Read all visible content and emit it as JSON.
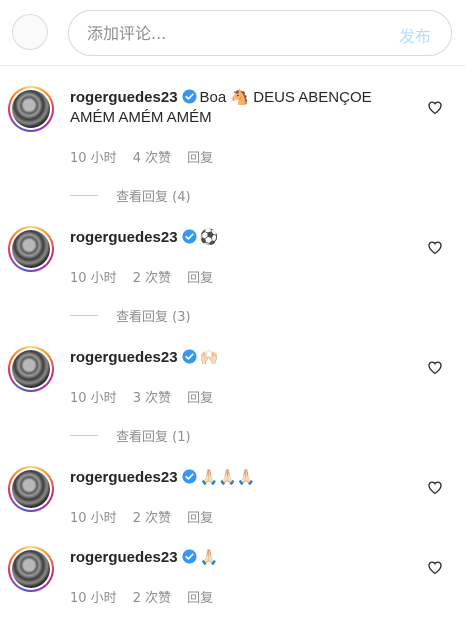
{
  "composer": {
    "placeholder": "添加评论...",
    "post_label": "发布"
  },
  "comments": [
    {
      "username": "rogerguedes23",
      "text": "Boa 🐴 DEUS ABENÇOE AMÉM AMÉM AMÉM",
      "time": "10 小时",
      "likes": "4 次赞",
      "reply": "回复",
      "view_replies": "查看回复 (4)"
    },
    {
      "username": "rogerguedes23",
      "text": "⚽",
      "time": "10 小时",
      "likes": "2 次赞",
      "reply": "回复",
      "view_replies": "查看回复 (3)"
    },
    {
      "username": "rogerguedes23",
      "text": "🙌🏻",
      "time": "10 小时",
      "likes": "3 次赞",
      "reply": "回复",
      "view_replies": "查看回复 (1)"
    },
    {
      "username": "rogerguedes23",
      "text": "🙏🏻🙏🏻🙏🏻",
      "time": "10 小时",
      "likes": "2 次赞",
      "reply": "回复"
    },
    {
      "username": "rogerguedes23",
      "text": "🙏🏻",
      "time": "10 小时",
      "likes": "2 次赞",
      "reply": "回复"
    }
  ],
  "colors": {
    "verified": "#3897f0",
    "muted_text": "#8e8e8e",
    "post_disabled": "#b2dffc"
  },
  "icons": {
    "verified": "verified-badge-icon",
    "like": "heart-outline-icon"
  }
}
